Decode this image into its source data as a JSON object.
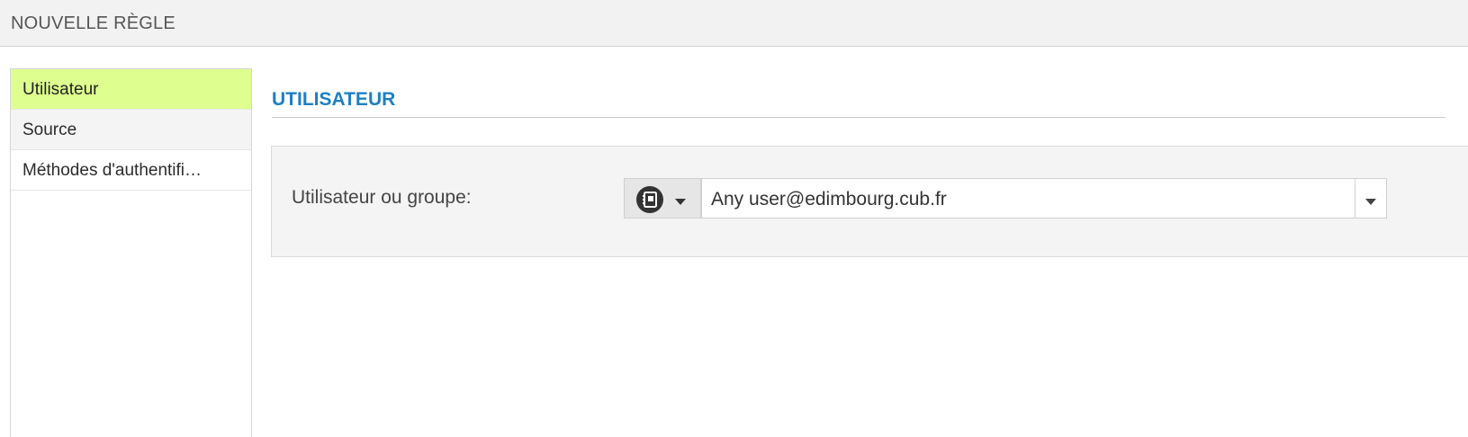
{
  "header": {
    "title": "NOUVELLE RÈGLE"
  },
  "sidebar": {
    "items": [
      {
        "label": "Utilisateur",
        "active": true
      },
      {
        "label": "Source",
        "active": false
      },
      {
        "label": "Méthodes d'authentifi…",
        "active": false
      }
    ]
  },
  "main": {
    "section_title": "UTILISATEUR",
    "field": {
      "label": "Utilisateur ou groupe:",
      "type_icon": "address-book-icon",
      "value": "Any user@edimbourg.cub.fr"
    }
  },
  "colors": {
    "active_item": "#deff8f",
    "section_title": "#1e7fc3",
    "panel_bg": "#f4f4f4"
  }
}
